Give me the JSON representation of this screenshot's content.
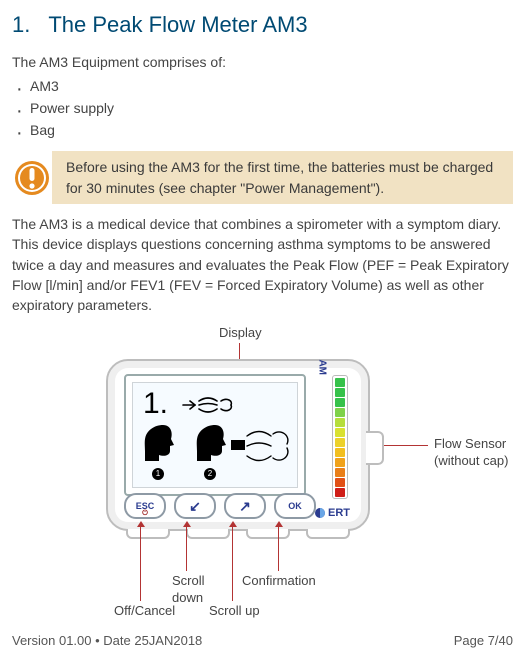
{
  "heading": {
    "number": "1.",
    "title": "The Peak Flow Meter AM3"
  },
  "intro": "The AM3 Equipment comprises of:",
  "bullets": [
    "AM3",
    "Power supply",
    "Bag"
  ],
  "notice": "Before using the AM3 for the first time, the batteries must be charged for 30 minutes (see chapter \"Power Management\").",
  "desc": "The AM3 is a medical device that combines a spirometer with a symptom diary. This device displays questions concerning asthma symptoms to be answered twice a day and measures and evaluates the Peak Flow (PEF = Peak Expiratory Flow [l/min] and/or FEV1 (FEV = Forced Expiratory Volume) as well as other expiratory parameters.",
  "labels": {
    "display": "Display",
    "flow_sensor_l1": "Flow Sensor",
    "flow_sensor_l2": "(without cap)",
    "off_cancel": "Off/Cancel",
    "scroll_down_l1": "Scroll",
    "scroll_down_l2": "down",
    "scroll_up": "Scroll up",
    "confirmation": "Confirmation"
  },
  "device": {
    "screen_number": "1.",
    "head_nums": [
      "1",
      "2"
    ],
    "brand_text": "AM",
    "logo_text": "ERT",
    "buttons": {
      "esc_top": "ESC",
      "esc_sub": "⏻",
      "down": "↙",
      "up": "↗",
      "ok": "OK"
    },
    "led_colors": [
      "#36c24a",
      "#36c24a",
      "#36c24a",
      "#7fd24a",
      "#b6de3c",
      "#d9e131",
      "#ecd12b",
      "#f2bf1f",
      "#f0a21a",
      "#e97f18",
      "#e15116",
      "#cf1d17"
    ]
  },
  "footer": {
    "version": "Version 01.00 • Date 25JAN2018",
    "page": "Page 7/40"
  }
}
